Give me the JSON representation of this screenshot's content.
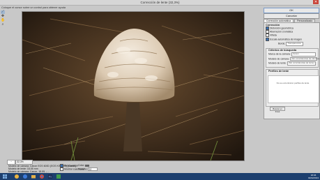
{
  "window": {
    "title": "Corrección de lente (32,3%)",
    "close_glyph": "✕"
  },
  "hint": "Coloque el cursor sobre un control para obtener ayuda",
  "tools": [
    "straighten-tool",
    "move-grid-tool",
    "hand-tool",
    "zoom-tool"
  ],
  "zoom": {
    "percent": "32,3%",
    "select": "32,3%"
  },
  "info": [
    "Modelo de cámara: Canon EOS 600D (EOS KISS X5) [Canon]",
    "Modelo de lente: 18-55 mm",
    "Modelo de cámara: Canon, 18-55, -, -"
  ],
  "options": {
    "preview": "Previsualizar",
    "grid": "Mostrar cuadrícula",
    "color_label": "Color:",
    "size_label": "Tamaño:",
    "size_value": "32"
  },
  "buttons": {
    "ok": "OK",
    "cancel": "Cancelar",
    "reset": "Buscar en línea"
  },
  "tabs": [
    "Corrección automática",
    "Personalizado"
  ],
  "panel": {
    "correction_title": "Corrección",
    "checks": [
      "Distorsión geométrica",
      "Aberración cromática",
      "Viñeta"
    ],
    "autoscale": "Escala automática de imagen",
    "edge_label": "Borde:",
    "edge_value": "Transparencia",
    "criteria_title": "Criterios de búsqueda",
    "criteria": [
      {
        "label": "Marca de la cámara:",
        "value": "Canon"
      },
      {
        "label": "Modelo de cámara:",
        "value": "(Sin coincidencias de cámara)"
      },
      {
        "label": "Modelo de lente:",
        "value": "(Sin coincidencias de lente)"
      }
    ],
    "profiles_title": "Perfiles de lente",
    "profiles_empty": "No se encontraron perfiles de lente"
  },
  "taskbar": {
    "time": "18:46",
    "date": "02/02/2013"
  },
  "colors": {
    "accent": "#3a6fb0",
    "taskbar": "#1d3f6e",
    "panel": "#e6e6e6"
  }
}
